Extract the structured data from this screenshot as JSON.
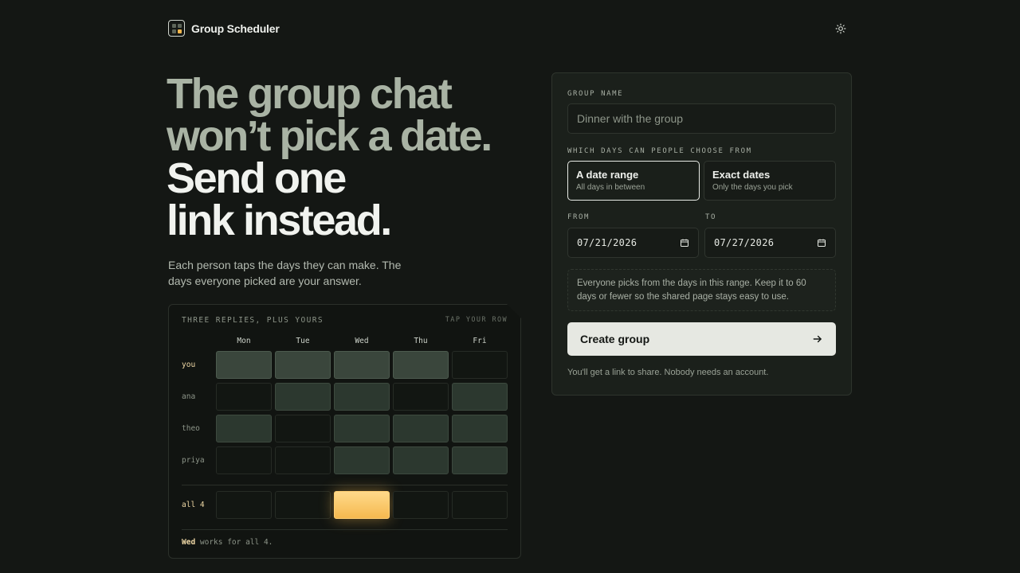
{
  "brand": {
    "name": "Group Scheduler"
  },
  "hero": {
    "line1": "The group chat",
    "line2": "won’t pick a date.",
    "line3": "Send one",
    "line4": "link instead.",
    "lede": "Each person taps the days they can make. The days everyone picked are your answer."
  },
  "preview": {
    "title": "THREE REPLIES, PLUS YOURS",
    "hint": "TAP YOUR ROW",
    "days": [
      "Mon",
      "Tue",
      "Wed",
      "Thu",
      "Fri"
    ],
    "rows": [
      {
        "name": "you",
        "avail": [
          true,
          true,
          true,
          true,
          false
        ]
      },
      {
        "name": "ana",
        "avail": [
          false,
          true,
          true,
          false,
          true
        ]
      },
      {
        "name": "theo",
        "avail": [
          true,
          false,
          true,
          true,
          true
        ]
      },
      {
        "name": "priya",
        "avail": [
          false,
          false,
          true,
          true,
          true
        ]
      }
    ],
    "all_label": "all 4",
    "all_match": "Wed",
    "footer_day": "Wed",
    "footer_text": " works for all 4."
  },
  "form": {
    "group_name_label": "GROUP NAME",
    "group_name_placeholder": "Dinner with the group",
    "mode_label": "WHICH DAYS CAN PEOPLE CHOOSE FROM",
    "mode_range_title": "A date range",
    "mode_range_sub": "All days in between",
    "mode_exact_title": "Exact dates",
    "mode_exact_sub": "Only the days you pick",
    "selected_mode": "A date range",
    "from_label": "FROM",
    "from_value": "07/21/2026",
    "to_label": "TO",
    "to_value": "07/27/2026",
    "note": "Everyone picks from the days in this range. Keep it to 60 days or fewer so the shared page stays easy to use.",
    "cta": "Create group",
    "subtext": "You'll get a link to share. Nobody needs an account."
  },
  "icons": {
    "theme": "sun-icon",
    "calendar": "calendar-icon",
    "arrow": "arrow-right-icon"
  },
  "colors": {
    "accent": "#f5b94f",
    "background": "#141714",
    "cta_bg": "#e6e8e2"
  }
}
